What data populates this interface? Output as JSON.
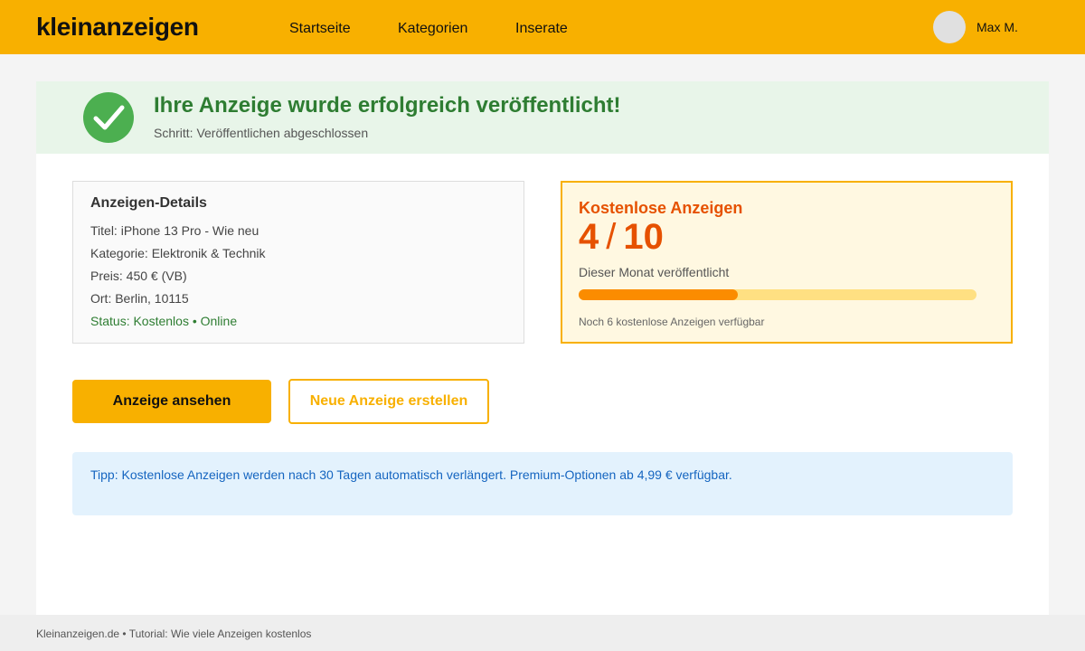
{
  "header": {
    "logo": "kleinanzeigen",
    "nav": [
      "Startseite",
      "Kategorien",
      "Inserate"
    ],
    "user_name": "Max M."
  },
  "banner": {
    "title": "Ihre Anzeige wurde erfolgreich veröffentlicht!",
    "subtitle": "Schritt: Veröffentlichen abgeschlossen"
  },
  "details": {
    "title": "Anzeigen-Details",
    "lines": [
      "Titel: iPhone 13 Pro - Wie neu",
      "Kategorie: Elektronik & Technik",
      "Preis: 450 € (VB)",
      "Ort: Berlin, 10115",
      "Status: Kostenlos • Online"
    ]
  },
  "quota": {
    "title": "Kostenlose Anzeigen",
    "used": "4",
    "total": "10",
    "progress_fraction": 0.4,
    "subtitle": "Dieser Monat veröffentlicht",
    "note": "Noch 6 kostenlose Anzeigen verfügbar"
  },
  "actions": {
    "view_label": "Anzeige ansehen",
    "new_label": "Neue Anzeige erstellen"
  },
  "tip": {
    "text": "Tipp: Kostenlose Anzeigen werden nach 30 Tagen automatisch verlängert. Premium-Optionen ab 4,99 € verfügbar."
  },
  "footer": {
    "text": "Kleinanzeigen.de • Tutorial: Wie viele Anzeigen kostenlos"
  },
  "colors": {
    "brand": "#f8b000",
    "success": "#2e7d32",
    "accent": "#e65100",
    "progress": "#fb8c00",
    "info": "#1565c0"
  }
}
